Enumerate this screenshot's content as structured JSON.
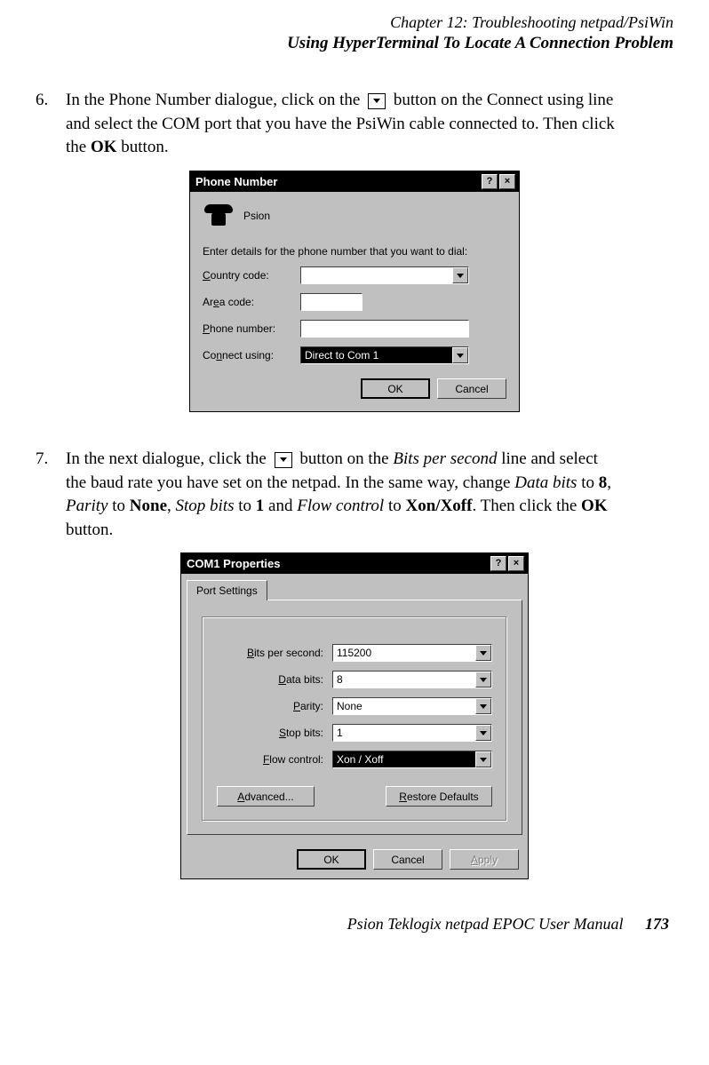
{
  "header": {
    "chapter": "Chapter 12:  Troubleshooting netpad/PsiWin",
    "section": "Using HyperTerminal To Locate A Connection Problem"
  },
  "step6": {
    "num": "6.",
    "t1": "In the Phone Number dialogue, click on the ",
    "t2": " button on the Connect using line and select the COM port that you have the PsiWin cable connected to. Then click the ",
    "ok": "OK",
    "t3": " button."
  },
  "phone_dialog": {
    "title": "Phone Number",
    "help_btn": "?",
    "close_btn": "×",
    "icon_label": "Psion",
    "prompt": "Enter details for the phone number that you want to dial:",
    "country_label_pre": "C",
    "country_label": "ountry code:",
    "area_label": "Ar",
    "area_label_u": "e",
    "area_label_post": "a code:",
    "phone_label_pre": "P",
    "phone_label": "hone number:",
    "connect_label": "Co",
    "connect_label_u": "n",
    "connect_label_post": "nect using:",
    "connect_value": "Direct to Com 1",
    "ok_btn": "OK",
    "cancel_btn": "Cancel"
  },
  "step7": {
    "num": "7.",
    "t1": "In the next dialogue, click the ",
    "t2": " button on the ",
    "bps": "Bits per second",
    "t3": " line and select the baud rate you have set on the netpad. In the same way, change ",
    "databits_i": "Data bits",
    "t4": " to ",
    "v8": "8",
    "c1": ", ",
    "parity_i": "Parity",
    "none": "None",
    "c2": ", ",
    "stopbits_i": "Stop bits",
    "v1": "1",
    "and": " and ",
    "flow_i": "Flow control",
    "to2": " to ",
    "xon": "Xon/Xoff",
    "t5": ". Then click the ",
    "ok": "OK",
    "t6": " button."
  },
  "com1_dialog": {
    "title": "COM1 Properties",
    "help_btn": "?",
    "close_btn": "×",
    "tab": "Port Settings",
    "bits_pre": "B",
    "bits_post": "its per second:",
    "bits_val": "115200",
    "data_pre": "D",
    "data_post": "ata bits:",
    "data_val": "8",
    "parity_pre": "P",
    "parity_post": "arity:",
    "parity_val": "None",
    "stop_pre": "S",
    "stop_post": "top bits:",
    "stop_val": "1",
    "flow_pre": "F",
    "flow_post": "low control:",
    "flow_val": "Xon / Xoff",
    "adv_pre": "A",
    "adv_post": "dvanced...",
    "restore_pre": "R",
    "restore_post": "estore Defaults",
    "ok_btn": "OK",
    "cancel_btn": "Cancel",
    "apply_pre": "A",
    "apply_post": "pply"
  },
  "footer": {
    "text": "Psion Teklogix netpad EPOC User Manual",
    "page": "173"
  }
}
